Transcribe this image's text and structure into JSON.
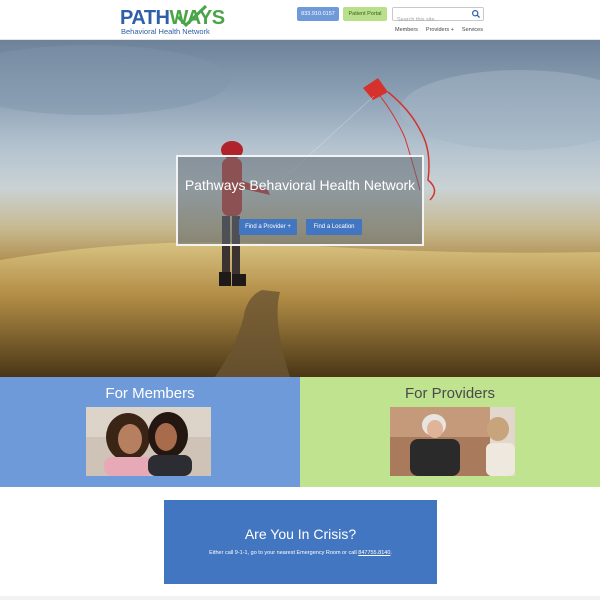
{
  "header": {
    "logo": {
      "word_left": "PATH",
      "word_right": "WAYS",
      "subtitle": "Behavioral Health Network"
    },
    "phone_button": "833.910.0157",
    "portal_button": "Patient Portal",
    "search": {
      "placeholder": "Search this site...",
      "icon": "search-icon"
    },
    "nav": [
      "Members",
      "Providers +",
      "Services"
    ]
  },
  "hero": {
    "title": "Pathways Behavioral Health Network",
    "buttons": [
      "Find a Provider +",
      "Find a Location"
    ]
  },
  "panels": {
    "members": {
      "title": "For Members"
    },
    "providers": {
      "title": "For Providers"
    }
  },
  "crisis": {
    "title": "Are You In Crisis?",
    "text_before": "Either call 9-1-1, go to your nearest Emergency Room or call ",
    "phone": "847755.8140",
    "text_after": "."
  },
  "colors": {
    "brand_blue": "#2e5fa8",
    "brand_green": "#4aa548",
    "members_panel": "#6f9ad9",
    "providers_panel": "#bfe38e",
    "button_blue": "#4376c1"
  }
}
